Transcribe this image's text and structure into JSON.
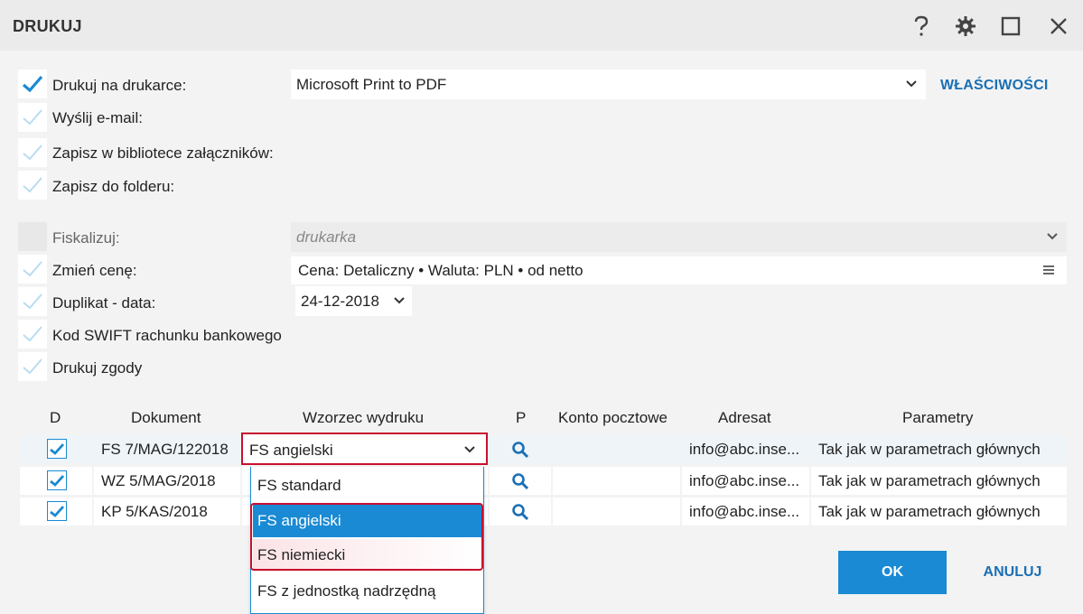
{
  "window": {
    "title": "DRUKUJ"
  },
  "options": {
    "print_on_printer": {
      "label": "Drukuj na drukarce:",
      "checked": true
    },
    "send_email": {
      "label": "Wyślij e-mail:",
      "checked": false
    },
    "save_library": {
      "label": "Zapisz w bibliotece załączników:",
      "checked": false
    },
    "save_folder": {
      "label": "Zapisz do folderu:",
      "checked": false
    },
    "fiscalize": {
      "label": "Fiskalizuj:",
      "value": "drukarka"
    },
    "change_price": {
      "label": "Zmień cenę:",
      "value": "Cena: Detaliczny • Waluta: PLN • od netto",
      "checked": false
    },
    "duplicate_date": {
      "label": "Duplikat - data:",
      "value": "24-12-2018",
      "checked": false
    },
    "swift": {
      "label": "Kod SWIFT rachunku bankowego",
      "checked": false
    },
    "consents": {
      "label": "Drukuj zgody",
      "checked": false
    }
  },
  "printer": {
    "value": "Microsoft Print to PDF",
    "properties_label": "WŁAŚCIWOŚCI"
  },
  "table": {
    "headers": [
      "D",
      "Dokument",
      "Wzorzec wydruku",
      "P",
      "Konto pocztowe",
      "Adresat",
      "Parametry"
    ],
    "rows": [
      {
        "checked": true,
        "document": "FS 7/MAG/122018",
        "template": "FS angielski",
        "account": "",
        "recipient": "info@abc.inse...",
        "params": "Tak jak w parametrach głównych"
      },
      {
        "checked": true,
        "document": "WZ 5/MAG/2018",
        "template": "",
        "account": "",
        "recipient": "info@abc.inse...",
        "params": "Tak jak w parametrach głównych"
      },
      {
        "checked": true,
        "document": "KP 5/KAS/2018",
        "template": "",
        "account": "",
        "recipient": "info@abc.inse...",
        "params": "Tak jak w parametrach głównych"
      }
    ]
  },
  "template_dropdown": {
    "options": [
      "FS standard",
      "FS angielski",
      "FS niemiecki",
      "FS z jednostką nadrzędną"
    ],
    "selected": "FS angielski"
  },
  "buttons": {
    "ok": "OK",
    "cancel": "ANULUJ"
  },
  "colors": {
    "accent": "#1a8ad4",
    "highlight_border": "#c8102e",
    "link": "#1a6fb5"
  }
}
